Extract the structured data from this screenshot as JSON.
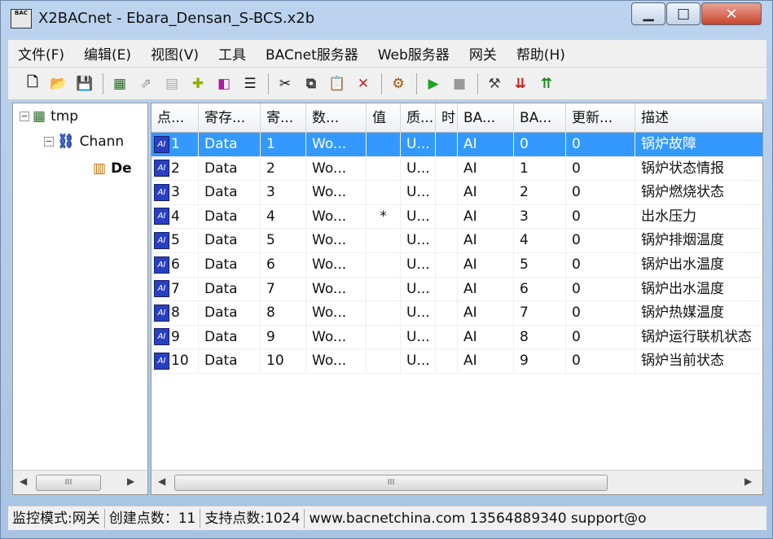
{
  "window": {
    "title": "X2BACnet - Ebara_Densan_S-BCS.x2b",
    "app_icon_text": "BAC"
  },
  "menu": [
    {
      "label": "文件(F)"
    },
    {
      "label": "编辑(E)"
    },
    {
      "label": "视图(V)"
    },
    {
      "label": "工具"
    },
    {
      "label": "BACnet服务器"
    },
    {
      "label": "Web服务器"
    },
    {
      "label": "网关"
    },
    {
      "label": "帮助(H)"
    }
  ],
  "toolbar": {
    "icons": [
      "new-file-icon",
      "open-folder-icon",
      "save-icon",
      "|",
      "device-icon",
      "point-icon",
      "table-icon",
      "add-folder-icon",
      "object-icon",
      "properties-icon",
      "|",
      "cut-icon",
      "copy-icon",
      "paste-icon",
      "delete-icon",
      "|",
      "tools-icon",
      "|",
      "run-icon",
      "stop-icon",
      "|",
      "build-icon",
      "load-icon",
      "upload-icon"
    ]
  },
  "tree": {
    "root": "tmp",
    "channel": "Chann",
    "device": "De"
  },
  "grid": {
    "headers": [
      "点...",
      "寄存...",
      "寄...",
      "数...",
      "值",
      "质...",
      "时",
      "BA...",
      "BA...",
      "更新...",
      "描述"
    ],
    "rows": [
      [
        "1",
        "Data",
        "1",
        "Wo...",
        "",
        "U...",
        "",
        "AI",
        "0",
        "0",
        "锅炉故障"
      ],
      [
        "2",
        "Data",
        "2",
        "Wo...",
        "",
        "U...",
        "",
        "AI",
        "1",
        "0",
        "锅炉状态情报"
      ],
      [
        "3",
        "Data",
        "3",
        "Wo...",
        "",
        "U...",
        "",
        "AI",
        "2",
        "0",
        "锅炉燃烧状态"
      ],
      [
        "4",
        "Data",
        "4",
        "Wo...",
        "*",
        "U...",
        "",
        "AI",
        "3",
        "0",
        "出水压力"
      ],
      [
        "5",
        "Data",
        "5",
        "Wo...",
        "",
        "U...",
        "",
        "AI",
        "4",
        "0",
        "锅炉排烟温度"
      ],
      [
        "6",
        "Data",
        "6",
        "Wo...",
        "",
        "U...",
        "",
        "AI",
        "5",
        "0",
        "锅炉出水温度"
      ],
      [
        "7",
        "Data",
        "7",
        "Wo...",
        "",
        "U...",
        "",
        "AI",
        "6",
        "0",
        "锅炉出水温度"
      ],
      [
        "8",
        "Data",
        "8",
        "Wo...",
        "",
        "U...",
        "",
        "AI",
        "7",
        "0",
        "锅炉热媒温度"
      ],
      [
        "9",
        "Data",
        "9",
        "Wo...",
        "",
        "U...",
        "",
        "AI",
        "8",
        "0",
        "锅炉运行联机状态"
      ],
      [
        "10",
        "Data",
        "10",
        "Wo...",
        "",
        "U...",
        "",
        "AI",
        "9",
        "0",
        "锅炉当前状态"
      ]
    ],
    "selected_row": 0
  },
  "scroll": {
    "arrow_left": "◀",
    "arrow_right": "▶",
    "thumb_mark": "III"
  },
  "status": [
    {
      "text": "监控模式:网关"
    },
    {
      "text": "创建点数：11"
    },
    {
      "text": "支持点数:1024"
    },
    {
      "text": "www.bacnetchina.com 13564889340 support@o"
    }
  ],
  "colors": {
    "selection": "#3399ff",
    "point_icon": "#2a3fc0"
  }
}
